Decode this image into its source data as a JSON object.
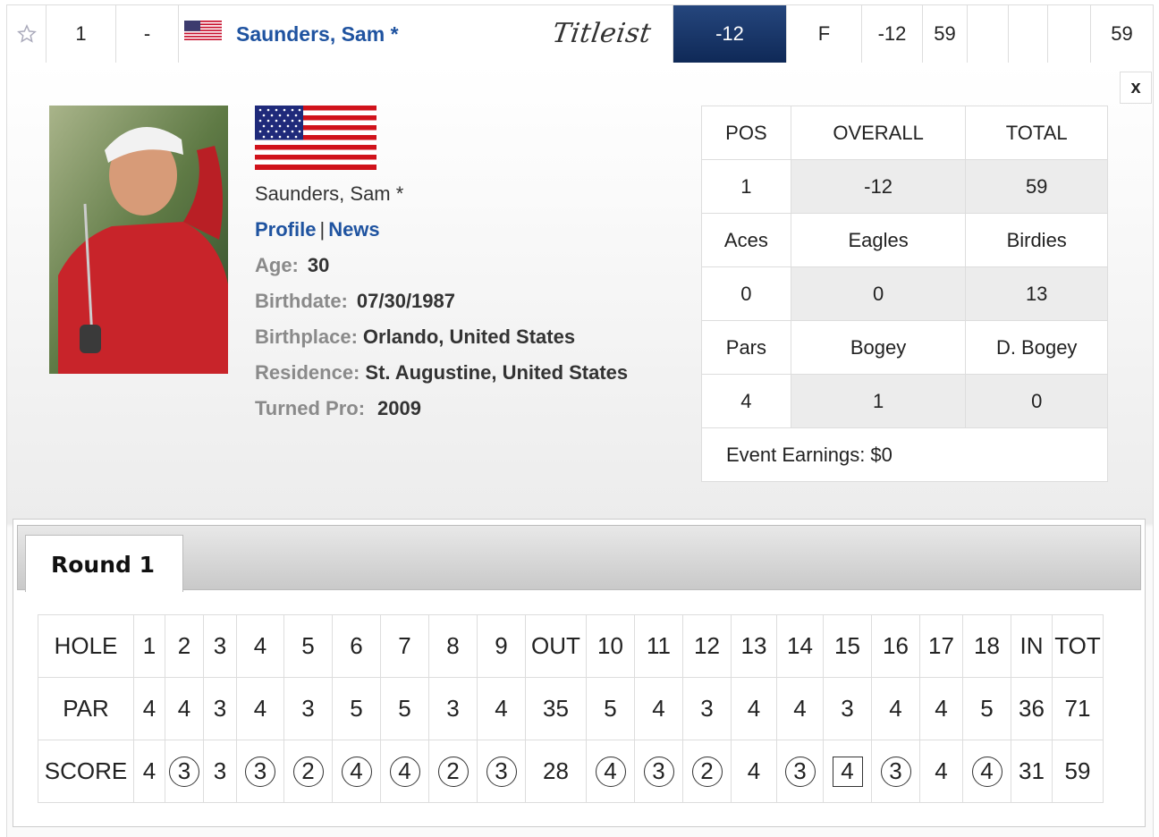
{
  "top_row": {
    "position": "1",
    "movement": "-",
    "player_name": "Saunders, Sam *",
    "sponsor_logo_text": "Titleist",
    "to_par": "-12",
    "thru": "F",
    "today": "-12",
    "r1": "59",
    "r2": "",
    "r3": "",
    "r4": "",
    "total": "59",
    "icons": {
      "favorite": "star-outline-icon",
      "flag": "us-flag-icon"
    },
    "accent_color": "#1b3a6e"
  },
  "panel": {
    "close_label": "x",
    "player_name": "Saunders, Sam *",
    "links": {
      "profile": "Profile",
      "separator": "|",
      "news": "News"
    },
    "bio": [
      {
        "key": "Age:",
        "value": "30"
      },
      {
        "key": "Birthdate:",
        "value": "07/30/1987"
      },
      {
        "key": "Birthplace:",
        "value": "Orlando, United States"
      },
      {
        "key": "Residence:",
        "value": "St. Augustine, United States"
      },
      {
        "key": "Turned Pro:",
        "value": "2009"
      }
    ],
    "stats": {
      "headers": [
        "POS",
        "OVERALL",
        "TOTAL"
      ],
      "values": [
        "1",
        "-12",
        "59"
      ],
      "labels2": [
        "Aces",
        "Eagles",
        "Birdies"
      ],
      "values2": [
        "0",
        "0",
        "13"
      ],
      "labels3": [
        "Pars",
        "Bogey",
        "D. Bogey"
      ],
      "values3": [
        "4",
        "1",
        "0"
      ],
      "earnings": "Event Earnings: $0"
    }
  },
  "scorecard": {
    "tab_label": "Round 1",
    "row_labels": [
      "HOLE",
      "PAR",
      "SCORE"
    ],
    "holes": [
      "1",
      "2",
      "3",
      "4",
      "5",
      "6",
      "7",
      "8",
      "9",
      "OUT",
      "10",
      "11",
      "12",
      "13",
      "14",
      "15",
      "16",
      "17",
      "18",
      "IN",
      "TOT"
    ],
    "par": [
      "4",
      "4",
      "3",
      "4",
      "3",
      "5",
      "5",
      "3",
      "4",
      "35",
      "5",
      "4",
      "3",
      "4",
      "4",
      "3",
      "4",
      "4",
      "5",
      "36",
      "71"
    ],
    "score": [
      "4",
      "3",
      "3",
      "3",
      "2",
      "4",
      "4",
      "2",
      "3",
      "28",
      "4",
      "3",
      "2",
      "4",
      "3",
      "4",
      "3",
      "4",
      "4",
      "31",
      "59"
    ],
    "score_marks": [
      "none",
      "circle",
      "none",
      "circle",
      "circle",
      "circle",
      "circle",
      "circle",
      "circle",
      "none",
      "circle",
      "circle",
      "circle",
      "none",
      "circle",
      "square",
      "circle",
      "none",
      "circle",
      "none",
      "none"
    ]
  }
}
